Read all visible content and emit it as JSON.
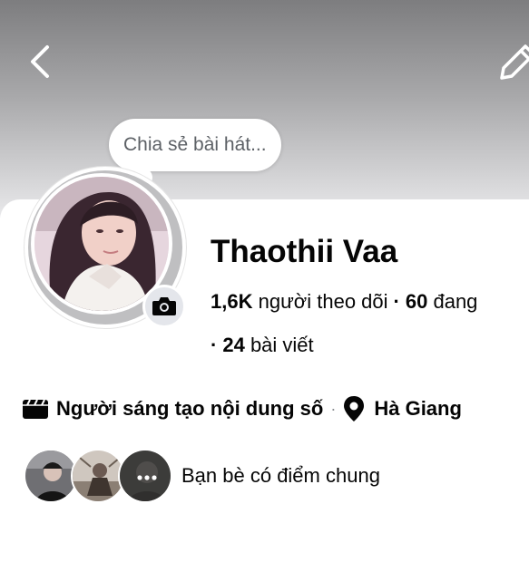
{
  "nav": {
    "back_icon": "chevron-left-icon",
    "edit_icon": "pencil-icon"
  },
  "note": {
    "placeholder": "Chia sẻ bài hát..."
  },
  "profile": {
    "name": "Thaothii Vaa",
    "followers_count": "1,6K",
    "followers_label": "người theo dõi",
    "following_count": "60",
    "following_label": "đang",
    "posts_count": "24",
    "posts_label": "bài viết"
  },
  "meta": {
    "category": "Người sáng tạo nội dung số",
    "category_icon": "clapperboard-icon",
    "location": "Hà Giang",
    "location_icon": "location-pin-icon"
  },
  "mutual": {
    "text": "Bạn bè có điểm chung",
    "more_icon": "more-dots-icon"
  },
  "colors": {
    "cover_top": "#7d7d7f",
    "cover_bottom": "#e9e9eb",
    "avatar_ring": "#bfbfc1",
    "chip_bg": "#e4e6eb"
  }
}
